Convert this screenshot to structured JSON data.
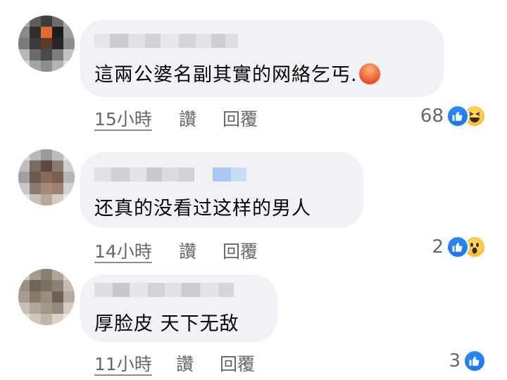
{
  "comments": [
    {
      "avatar_icon": "blurred-avatar",
      "avatar_colors": [
        "#a9a9a9",
        "#5d5d5d",
        "#3c3c3c",
        "#6b6b6b",
        "#b0b0b0",
        "#8a8a8a",
        "#2f2f2f",
        "#e06a2c",
        "#1c1c1c",
        "#9e9e9e",
        "#7a7a7a",
        "#3a3a3a",
        "#5a3a2a",
        "#262626",
        "#8c8c8c",
        "#b8b8b8",
        "#6a6a6a",
        "#4a4a4a",
        "#7d7d7d",
        "#c2c2c2",
        "#d0d0d0",
        "#a5a5a5",
        "#8e8e8e",
        "#b3b3b3",
        "#dcdcdc"
      ],
      "text": "這兩公婆名副其實的网絡乞丐.",
      "trailing_emoji": "angry-emoji",
      "time": "15小時",
      "like_label": "讚",
      "reply_label": "回覆",
      "reaction_count": "68",
      "reactions": [
        "like-icon",
        "haha-icon"
      ]
    },
    {
      "avatar_icon": "blurred-avatar",
      "avatar_colors": [
        "#d8d8d8",
        "#b9b9b9",
        "#9a9a9a",
        "#bcbcbc",
        "#e0e0e0",
        "#bdbdbd",
        "#7a6a60",
        "#5a4a42",
        "#8a7a70",
        "#cfcfcf",
        "#a0a0a0",
        "#6b5a50",
        "#8b6a5a",
        "#7a5e50",
        "#b6b6b6",
        "#c8c8c8",
        "#8a7a72",
        "#a58a7a",
        "#9b8272",
        "#d2d2d2",
        "#e4e4e4",
        "#cbc0b8",
        "#b8a89c",
        "#d6ccc4",
        "#e8e8e8"
      ],
      "text": "还真的没看过这样的男人",
      "time": "14小時",
      "like_label": "讚",
      "reply_label": "回覆",
      "reaction_count": "2",
      "reactions": [
        "like-icon",
        "wow-icon"
      ]
    },
    {
      "avatar_icon": "blurred-avatar",
      "avatar_colors": [
        "#cfc8c0",
        "#a59a8c",
        "#8a7f70",
        "#b0a698",
        "#d8d2cc",
        "#9a8f82",
        "#6f6456",
        "#7c7062",
        "#8c8174",
        "#c4bcb2",
        "#a69c90",
        "#857a6c",
        "#9b8e80",
        "#6e6254",
        "#b4aa9e",
        "#c8c0b6",
        "#b2a79a",
        "#a39786",
        "#958a7c",
        "#d4cdc4",
        "#e2ddd6",
        "#cfc7bc",
        "#bfb5a8",
        "#d9d2c8",
        "#ebe7e2"
      ],
      "text": "厚脸皮 天下无敌",
      "time": "11小時",
      "like_label": "讚",
      "reply_label": "回覆",
      "reaction_count": "3",
      "reactions": [
        "like-icon"
      ]
    }
  ],
  "colors": {
    "bubble_bg": "#f0f2f5",
    "meta_text": "#65676b",
    "like_blue": "#1877f2",
    "reaction_yellow": "#f7b125"
  }
}
